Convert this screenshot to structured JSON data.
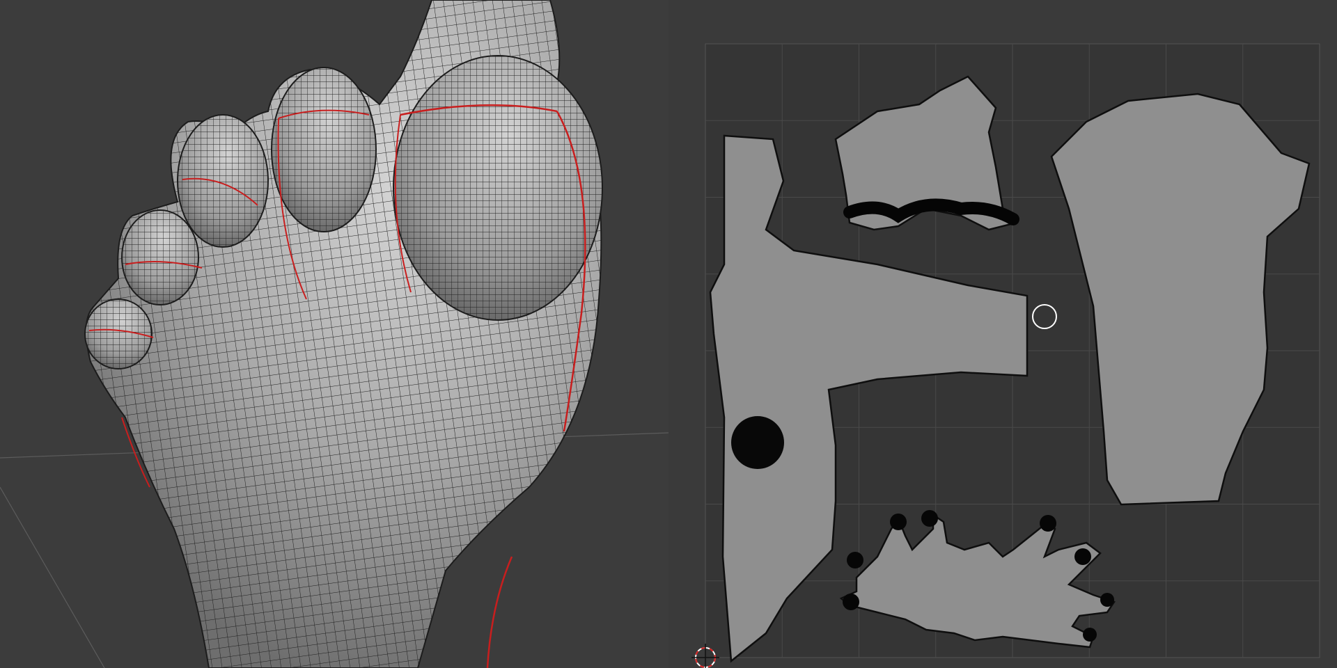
{
  "viewport": {
    "label": "",
    "colors": {
      "background": "#3c3c3c",
      "mesh": "#b9b9b9",
      "mesh_shade": "#7e7e7e",
      "wire": "#1a1a1a",
      "seam": "#c81e1e",
      "ground_line": "#6a6a6a"
    },
    "object": "foot-mesh",
    "toes": 5,
    "seam_lines": 6
  },
  "uv_editor": {
    "label": "",
    "colors": {
      "background": "#3a3a3a",
      "uv_area": "#353535",
      "grid": "#4b4b4b",
      "island_fill": "#8f8f8f",
      "island_wire": "#161616",
      "vertex": "#000000",
      "cursor": "#ffffff",
      "cursor_red": "#d62020"
    },
    "islands": [
      "sole-top-island",
      "toe-pad-island",
      "foot-side-island",
      "instep-island",
      "toes-fan-island"
    ],
    "grid_divisions": 8,
    "show_cursor": true
  }
}
